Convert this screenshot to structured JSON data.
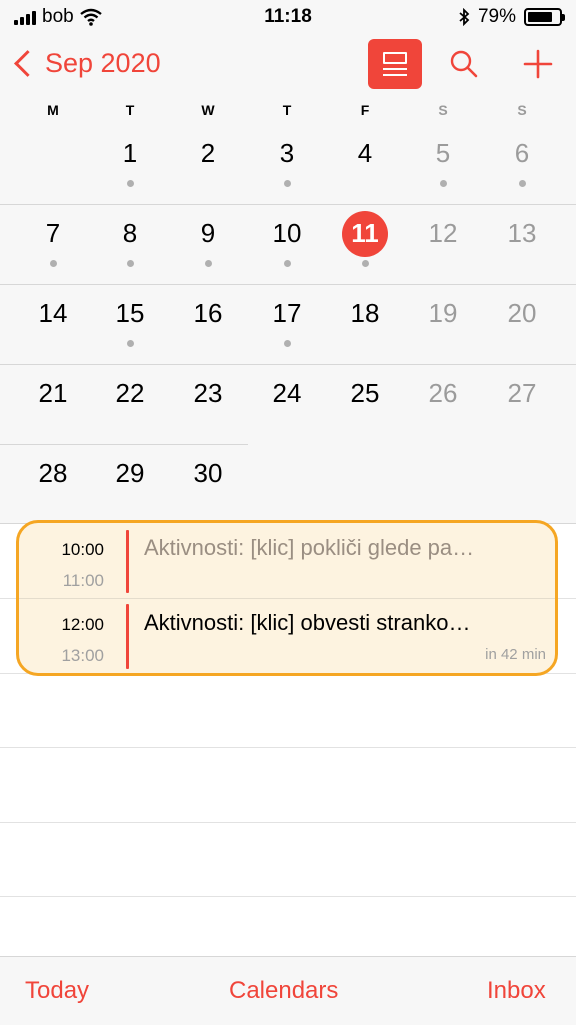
{
  "status": {
    "carrier": "bob",
    "time": "11:18",
    "battery": "79%",
    "battery_level": 0.79,
    "icons": [
      "signal-icon",
      "wifi-icon",
      "bluetooth-icon",
      "battery-icon"
    ]
  },
  "nav": {
    "back_label": "Sep 2020",
    "buttons": [
      "list-view-icon",
      "search-icon",
      "add-icon"
    ]
  },
  "weekdays": [
    "M",
    "T",
    "W",
    "T",
    "F",
    "S",
    "S"
  ],
  "calendar": {
    "rows": [
      [
        {
          "d": ""
        },
        {
          "d": "1",
          "dot": true
        },
        {
          "d": "2"
        },
        {
          "d": "3",
          "dot": true
        },
        {
          "d": "4"
        },
        {
          "d": "5",
          "dot": true
        },
        {
          "d": "6",
          "dot": true
        }
      ],
      [
        {
          "d": "7",
          "dot": true
        },
        {
          "d": "8",
          "dot": true
        },
        {
          "d": "9",
          "dot": true
        },
        {
          "d": "10",
          "dot": true
        },
        {
          "d": "11",
          "dot": true,
          "today": true
        },
        {
          "d": "12"
        },
        {
          "d": "13"
        }
      ],
      [
        {
          "d": "14"
        },
        {
          "d": "15",
          "dot": true
        },
        {
          "d": "16"
        },
        {
          "d": "17",
          "dot": true
        },
        {
          "d": "18"
        },
        {
          "d": "19"
        },
        {
          "d": "20"
        }
      ],
      [
        {
          "d": "21"
        },
        {
          "d": "22"
        },
        {
          "d": "23"
        },
        {
          "d": "24"
        },
        {
          "d": "25"
        },
        {
          "d": "26"
        },
        {
          "d": "27"
        }
      ],
      [
        {
          "d": "28"
        },
        {
          "d": "29"
        },
        {
          "d": "30"
        }
      ]
    ]
  },
  "events": [
    {
      "start": "10:00",
      "end": "11:00",
      "title": "Aktivnosti: [klic] pokliči glede pa…",
      "past": true,
      "note": ""
    },
    {
      "start": "12:00",
      "end": "13:00",
      "title": "Aktivnosti: [klic] obvesti stranko…",
      "past": false,
      "note": "in 42 min"
    }
  ],
  "tabs": {
    "today": "Today",
    "calendars": "Calendars",
    "inbox": "Inbox"
  },
  "colors": {
    "accent": "#f0453a",
    "highlight_border": "#f5a623",
    "highlight_fill": "#fdf3e0"
  }
}
